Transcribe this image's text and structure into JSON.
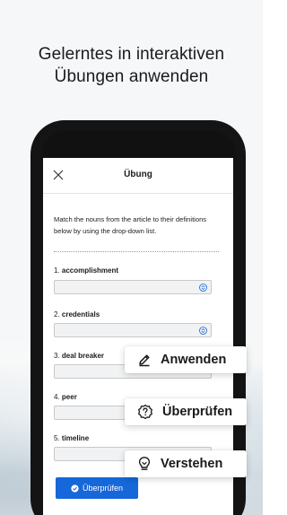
{
  "promo": {
    "headline_line1": "Gelerntes in interaktiven",
    "headline_line2": "Übungen anwenden"
  },
  "exercise": {
    "title": "Übung",
    "instructions": "Match the nouns from the article to their definitions below by using the drop-down list.",
    "questions": [
      {
        "number": "1.",
        "term": "accomplishment"
      },
      {
        "number": "2.",
        "term": "credentials"
      },
      {
        "number": "3.",
        "term": "deal breaker"
      },
      {
        "number": "4.",
        "term": "peer"
      },
      {
        "number": "5.",
        "term": "timeline"
      }
    ],
    "check_button_label": "Überprüfen"
  },
  "feature_cards": [
    {
      "label": "Anwenden",
      "icon": "pencil-icon"
    },
    {
      "label": "Überprüfen",
      "icon": "question-badge-icon"
    },
    {
      "label": "Verstehen",
      "icon": "lightbulb-icon"
    }
  ],
  "colors": {
    "accent": "#1667d9",
    "select_arrow": "#1667d9"
  }
}
